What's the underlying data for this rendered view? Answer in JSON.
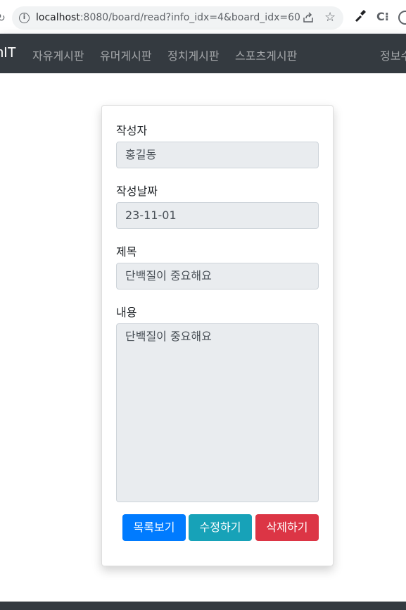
{
  "browser": {
    "url_host": "localhost",
    "url_rest": ":8080/board/read?info_idx=4&board_idx=60"
  },
  "navbar": {
    "brand": "nIT",
    "links": [
      "자유게시판",
      "유머게시판",
      "정치게시판",
      "스포츠게시판"
    ],
    "right_link": "정보수"
  },
  "form": {
    "writer_label": "작성자",
    "writer_value": "홍길동",
    "date_label": "작성날짜",
    "date_value": "23-11-01",
    "subject_label": "제목",
    "subject_value": "단백질이 중요해요",
    "content_label": "내용",
    "content_value": "단백질이 중요해요"
  },
  "buttons": {
    "list": "목록보기",
    "edit": "수정하기",
    "delete": "삭제하기"
  },
  "colors": {
    "navbar_bg": "#343a40",
    "primary": "#007bff",
    "info": "#17a2b8",
    "danger": "#dc3545"
  }
}
